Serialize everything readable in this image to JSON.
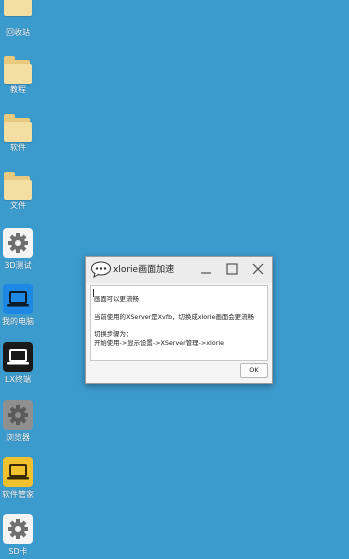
{
  "desktop": {
    "background": "#3c9bcd",
    "icons": [
      {
        "label": "回收站",
        "icon": "folder-icon"
      },
      {
        "label": "教程",
        "icon": "folder-icon"
      },
      {
        "label": "软件",
        "icon": "folder-icon"
      },
      {
        "label": "文件",
        "icon": "folder-icon"
      },
      {
        "label": "3D测试",
        "icon": "gear-icon"
      },
      {
        "label": "我的电脑",
        "icon": "laptop-icon"
      },
      {
        "label": "LX终端",
        "icon": "terminal-icon"
      },
      {
        "label": "浏览器",
        "icon": "gear-icon"
      },
      {
        "label": "软件管家",
        "icon": "laptop-icon"
      },
      {
        "label": "SD卡",
        "icon": "gear-icon"
      }
    ]
  },
  "dialog": {
    "title": "xlorie画面加速",
    "lines": [
      "画面可以更流畅",
      "当前使用的XServer是Xvfb，切换成xlorie画面会更流畅",
      "切换步骤为：",
      "开始使用->显示设置->XServer管理->xlorie"
    ],
    "ok_label": "OK"
  },
  "colors": {
    "tile_blue": "#1e88e5",
    "tile_black": "#1a1a1a",
    "tile_yellow": "#f2c12e",
    "tile_gray": "#8f8f8f",
    "folder": "#f4dfa3"
  }
}
